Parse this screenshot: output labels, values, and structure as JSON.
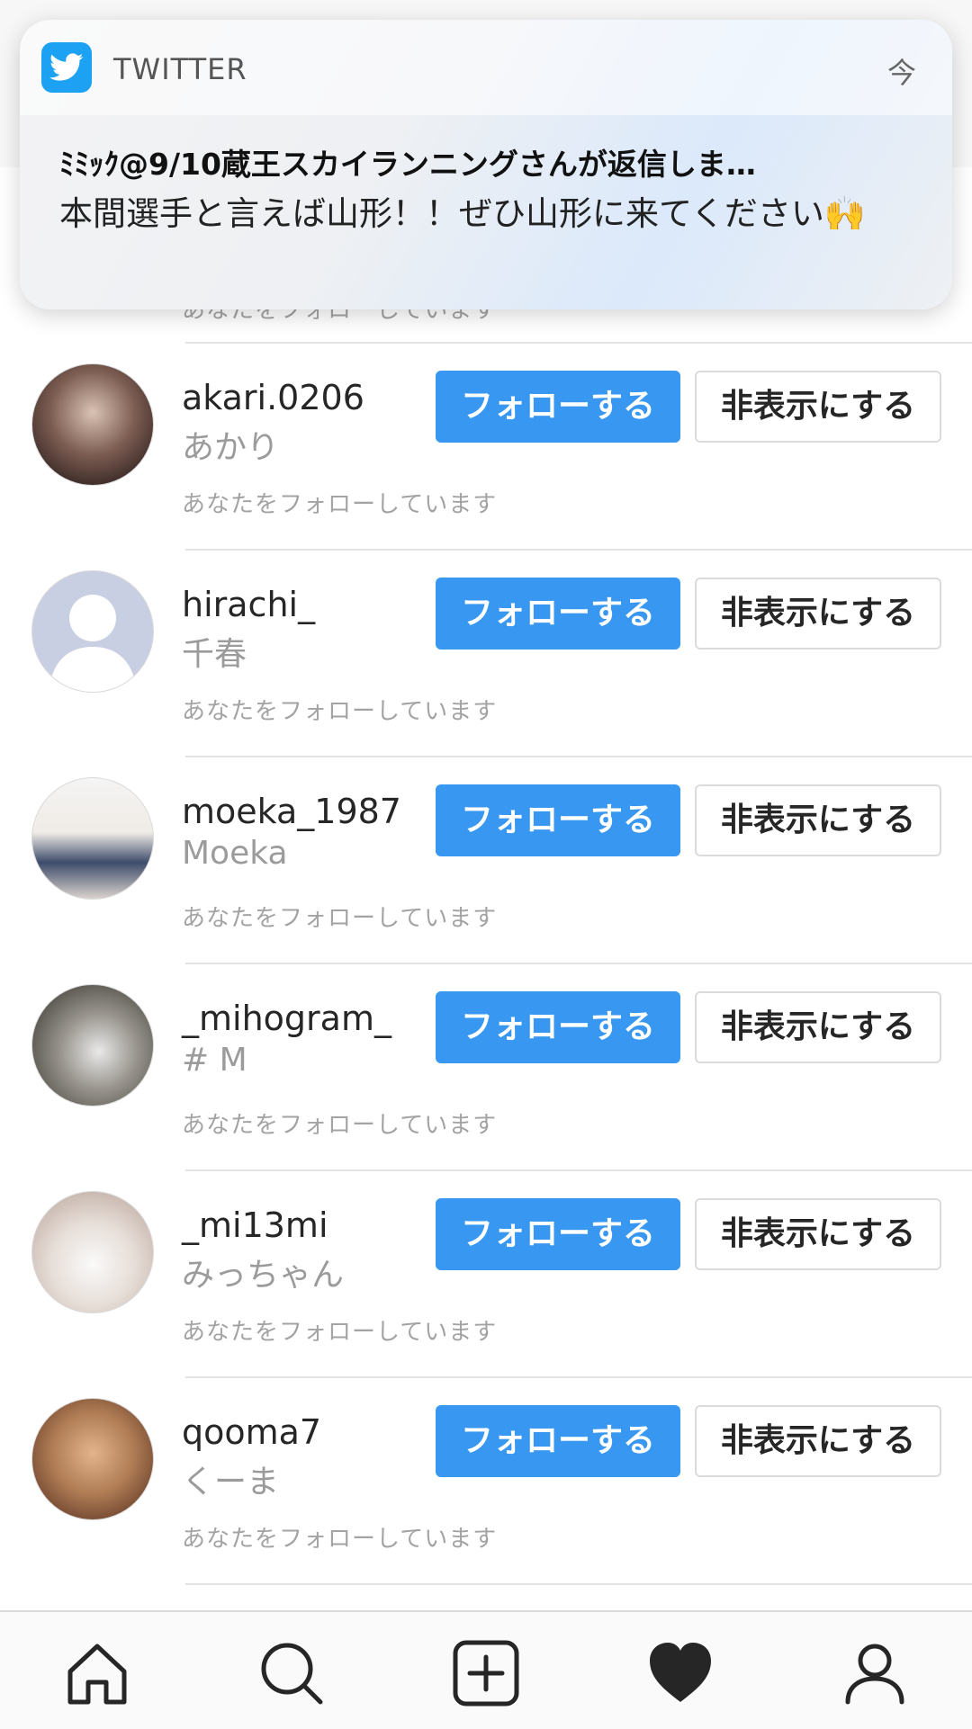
{
  "notification": {
    "app_name": "TWITTER",
    "time": "今",
    "title": "ﾐﾐｯｸ@9/10蔵王スカイランニングさんが返信しま…",
    "body": "本間選手と言えば山形！！ぜひ山形に来てください🙌"
  },
  "partial_row": {
    "status": "あなたをフォローしています"
  },
  "suggestions": [
    {
      "username": "akari.0206",
      "full_name": "あかり",
      "follow_label": "フォローする",
      "hide_label": "非表示にする",
      "status": "あなたをフォローしています"
    },
    {
      "username": "hirachi_",
      "full_name": "千春",
      "follow_label": "フォローする",
      "hide_label": "非表示にする",
      "status": "あなたをフォローしています"
    },
    {
      "username": "moeka_1987",
      "full_name": "Moeka",
      "follow_label": "フォローする",
      "hide_label": "非表示にする",
      "status": "あなたをフォローしています"
    },
    {
      "username": "_mihogram_",
      "full_name": "# M",
      "follow_label": "フォローする",
      "hide_label": "非表示にする",
      "status": "あなたをフォローしています"
    },
    {
      "username": "_mi13mi",
      "full_name": "みっちゃん",
      "follow_label": "フォローする",
      "hide_label": "非表示にする",
      "status": "あなたをフォローしています"
    },
    {
      "username": "qooma7",
      "full_name": "くーま",
      "follow_label": "フォローする",
      "hide_label": "非表示にする",
      "status": "あなたをフォローしています"
    }
  ],
  "tabbar": {
    "items": [
      "home-icon",
      "search-icon",
      "new-post-icon",
      "activity-heart-icon",
      "profile-icon"
    ]
  },
  "colors": {
    "accent": "#3897f0",
    "twitter": "#1da1f2",
    "secondary_text": "#9b9b9b"
  }
}
